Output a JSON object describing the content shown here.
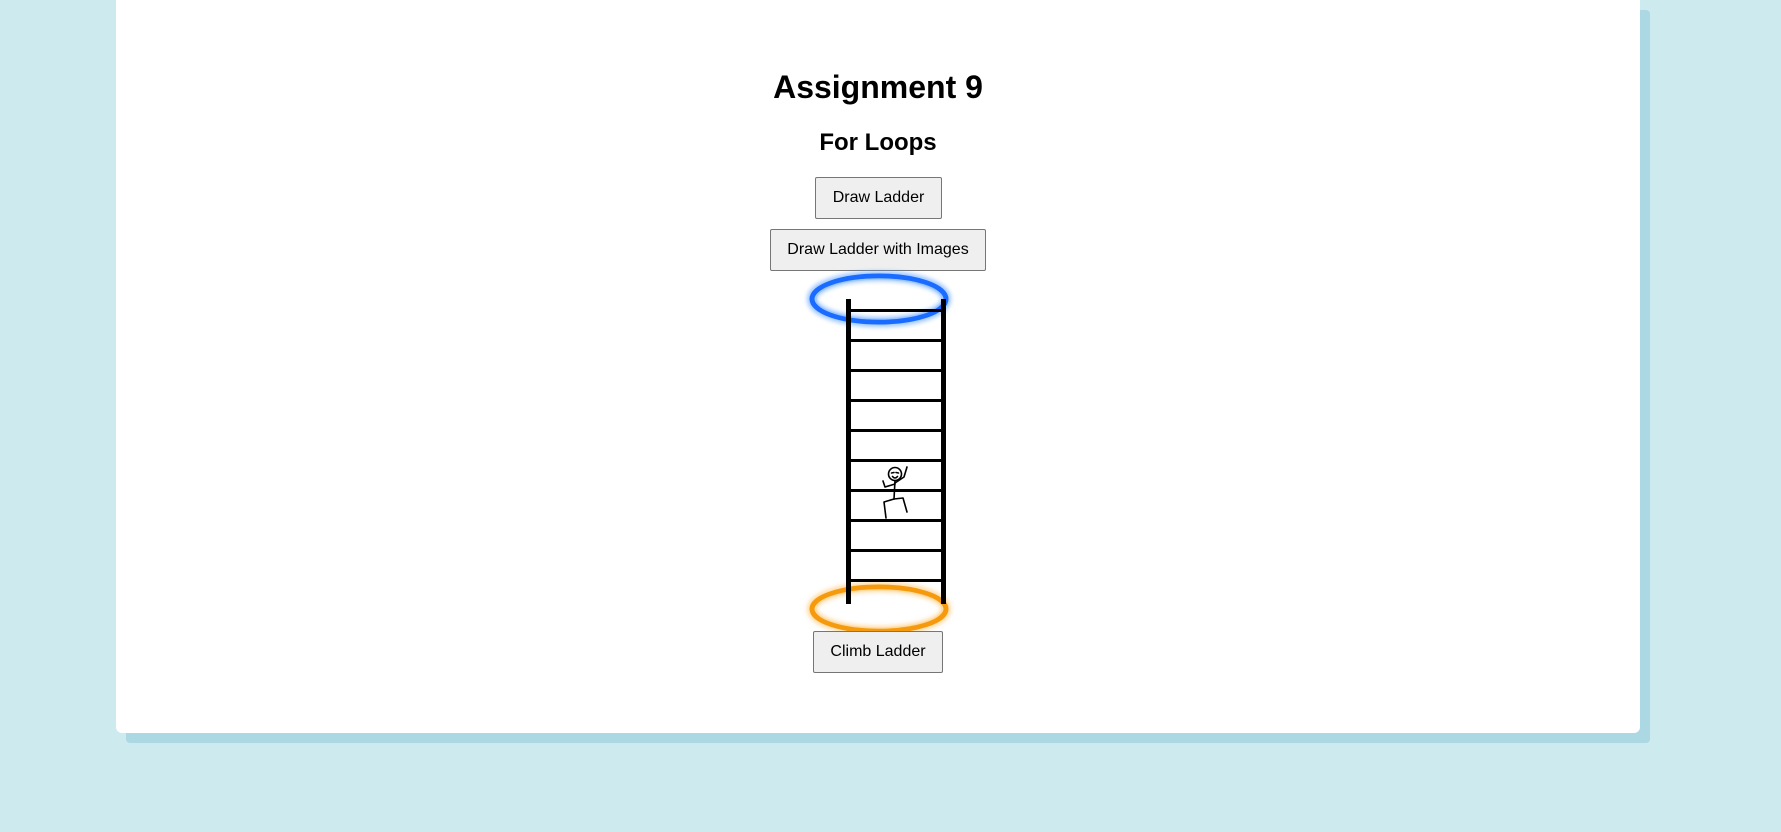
{
  "page": {
    "title": "Assignment 9",
    "subtitle": "For Loops"
  },
  "buttons": {
    "draw_ladder": "Draw Ladder",
    "draw_ladder_images": "Draw Ladder with Images",
    "climb_ladder": "Climb Ladder"
  },
  "ladder": {
    "rungs": 10
  },
  "portals": {
    "top_color": "#1a6bff",
    "bottom_color": "#f59a0c"
  },
  "colors": {
    "background": "#cdeaee",
    "card": "#ffffff",
    "card_shadow": "#acd8e4"
  }
}
